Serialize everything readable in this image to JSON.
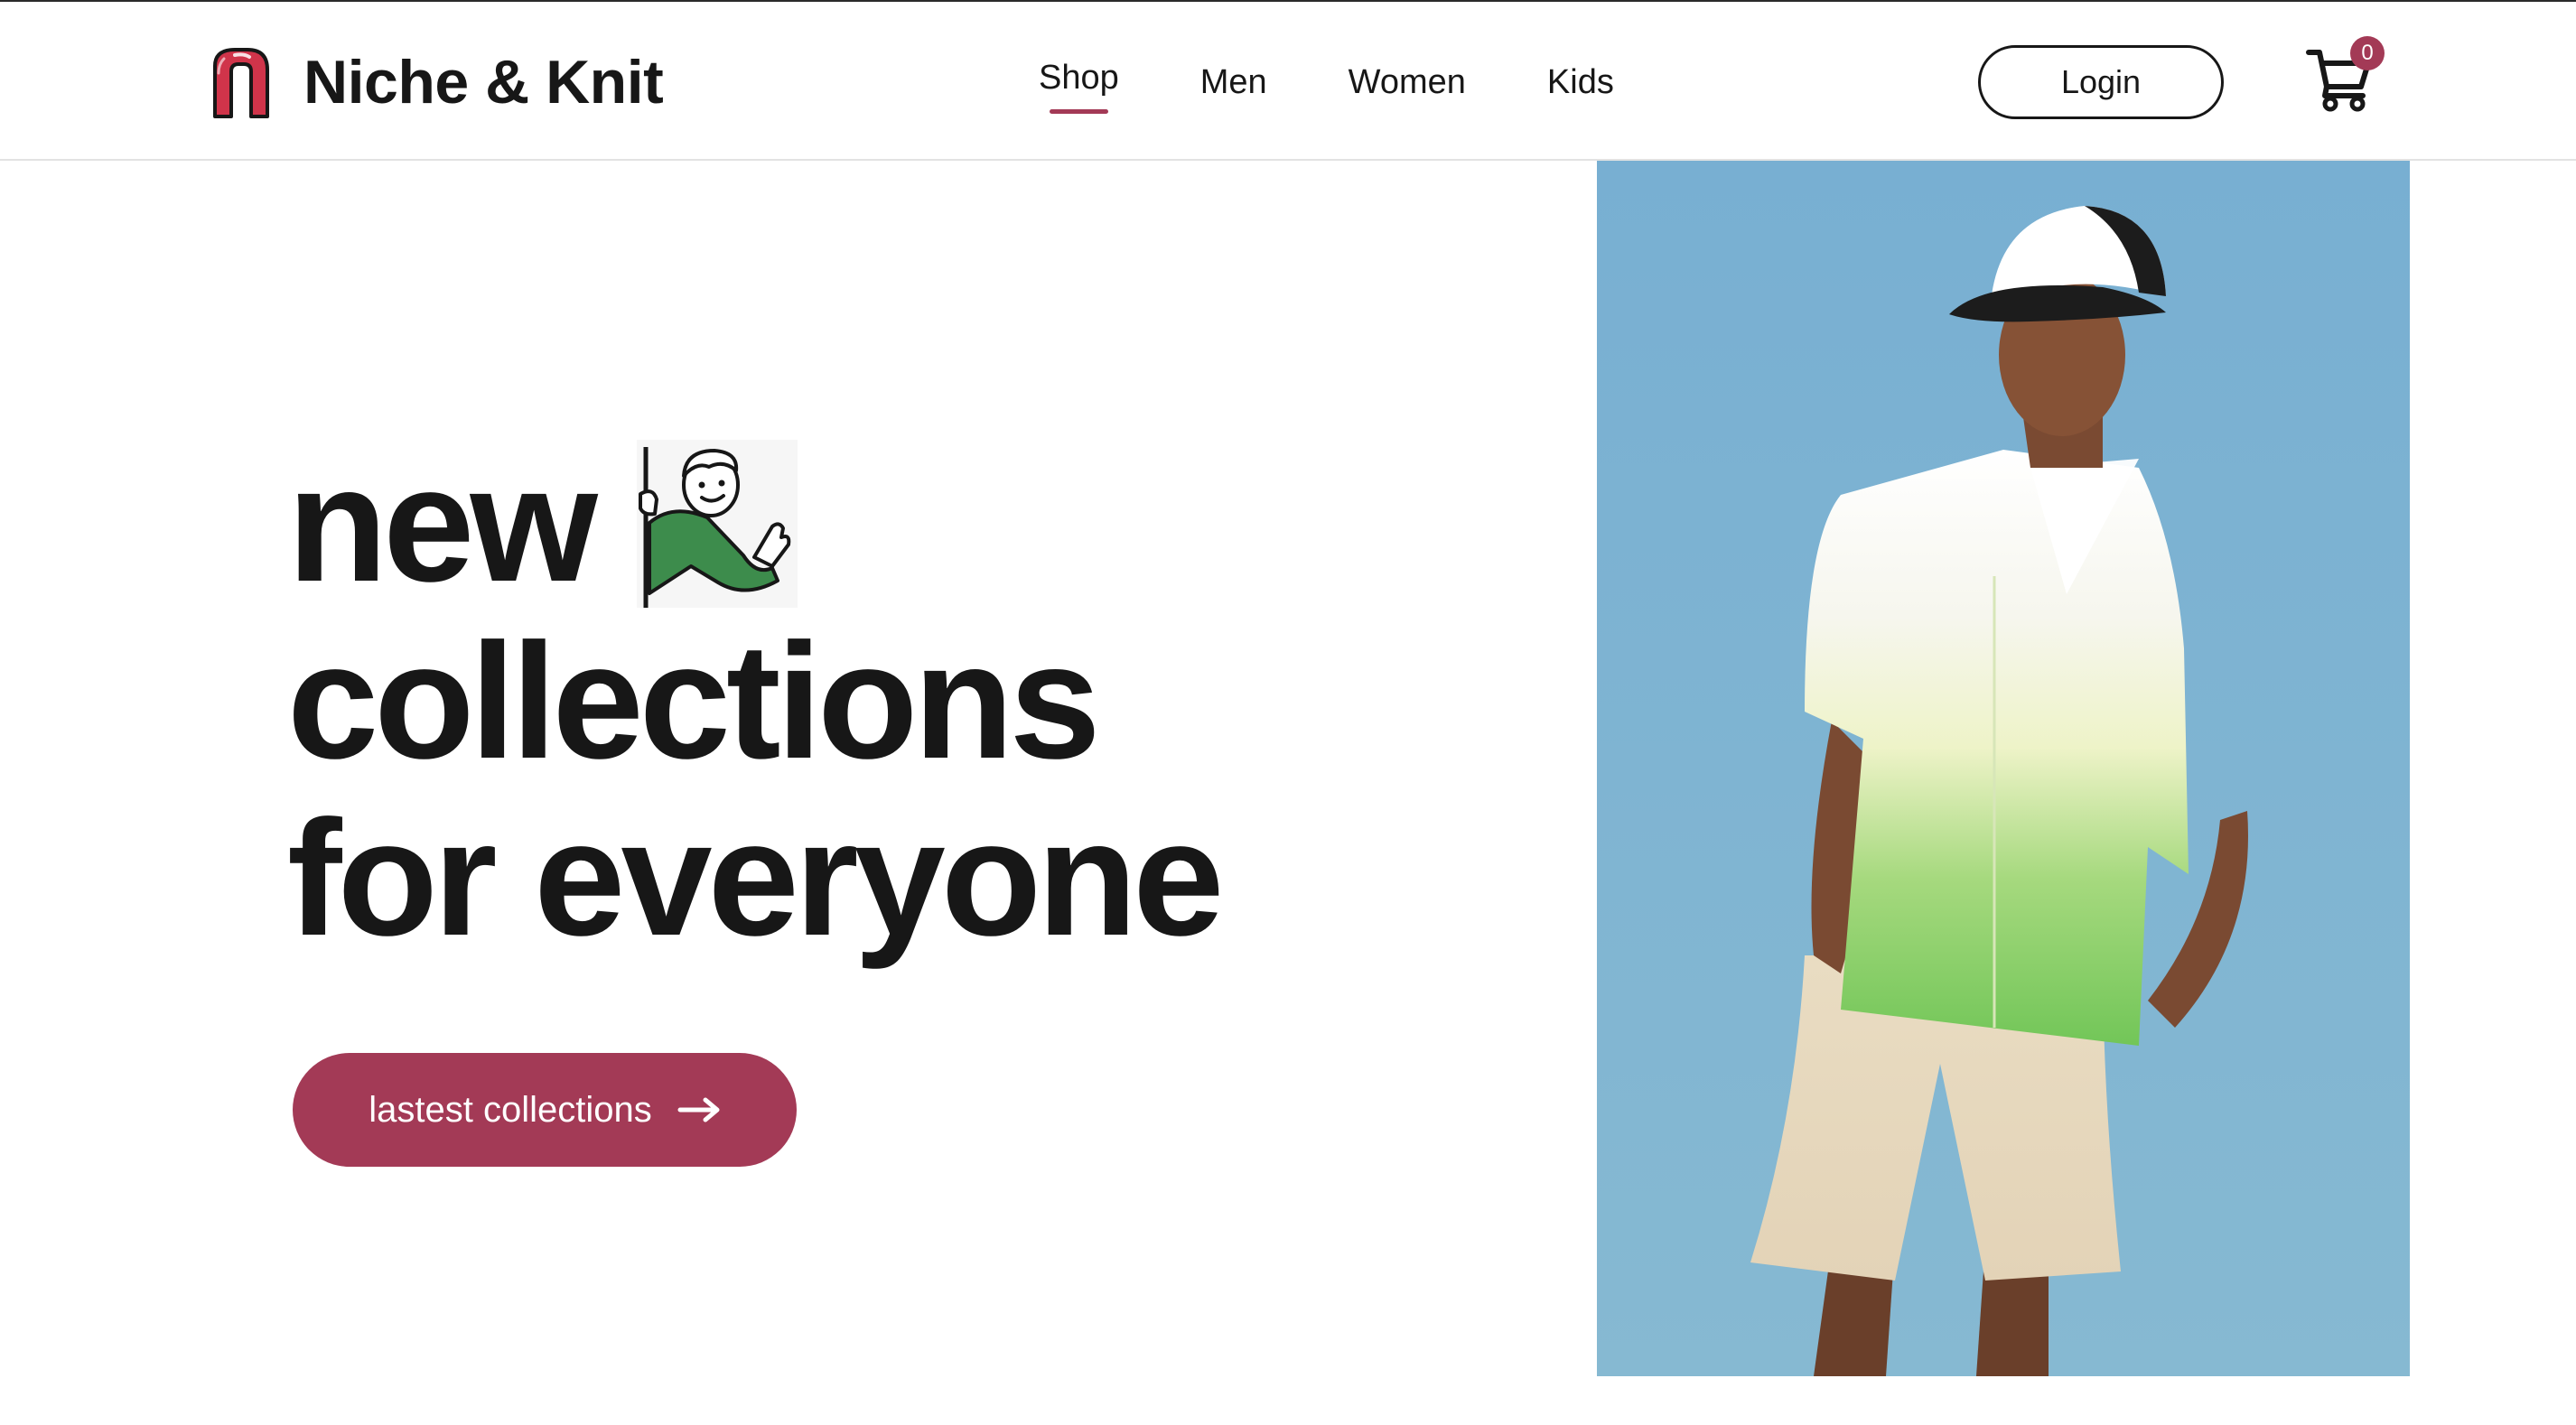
{
  "brand": {
    "name": "Niche & Knit",
    "logo_icon": "n-letter-logo-icon",
    "accent_color": "#a33a56"
  },
  "nav": {
    "items": [
      {
        "label": "Shop",
        "active": true
      },
      {
        "label": "Men",
        "active": false
      },
      {
        "label": "Women",
        "active": false
      },
      {
        "label": "Kids",
        "active": false
      }
    ]
  },
  "header": {
    "login_label": "Login",
    "cart_icon": "shopping-cart-icon",
    "cart_count": "0"
  },
  "hero": {
    "line1": "new",
    "line2": "collections",
    "line3": "for everyone",
    "mascot_icon": "waving-man-illustration",
    "cta_label": "lastest collections",
    "cta_icon": "arrow-right-icon",
    "image_description_icon": "model-photo"
  },
  "colors": {
    "text": "#171717",
    "accent": "#a33a56",
    "image_sky": "#7fb1cf"
  }
}
